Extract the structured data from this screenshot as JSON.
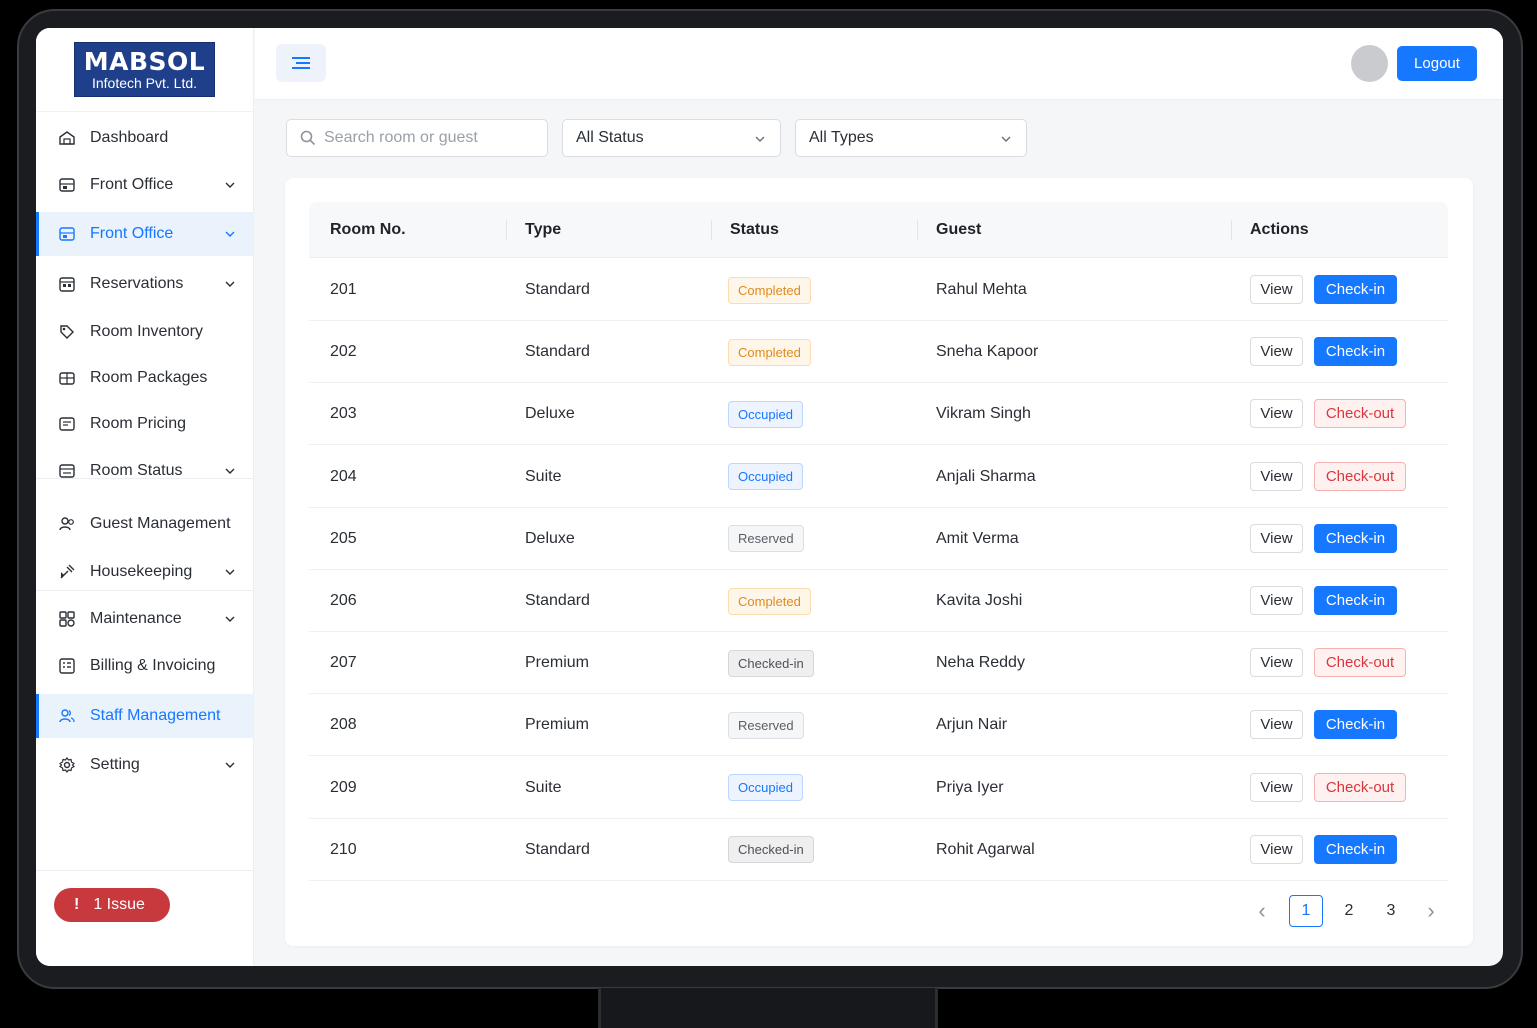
{
  "brand": {
    "line1": "MABSOL",
    "line2": "Infotech Pvt. Ltd."
  },
  "sidebar": {
    "items": [
      {
        "label": "Dashboard",
        "icon": "dashboard-icon",
        "chevron": false,
        "active": false
      },
      {
        "label": "Front Office",
        "icon": "front-office-icon",
        "chevron": true,
        "active": false
      },
      {
        "label": "Front Office",
        "icon": "front-office-icon",
        "chevron": true,
        "active": true
      },
      {
        "label": "Reservations",
        "icon": "reservations-icon",
        "chevron": true,
        "active": false
      },
      {
        "label": "Room Inventory",
        "icon": "room-inventory-icon",
        "chevron": false,
        "active": false
      },
      {
        "label": "Room Packages",
        "icon": "room-packages-icon",
        "chevron": false,
        "active": false
      },
      {
        "label": "Room Pricing",
        "icon": "room-pricing-icon",
        "chevron": false,
        "active": false
      },
      {
        "label": "Room Status",
        "icon": "room-status-icon",
        "chevron": true,
        "active": false
      },
      {
        "label": "Guest Management",
        "icon": "guest-management-icon",
        "chevron": false,
        "active": false
      },
      {
        "label": "Housekeeping",
        "icon": "housekeeping-icon",
        "chevron": true,
        "active": false
      },
      {
        "label": "Maintenance",
        "icon": "maintenance-icon",
        "chevron": true,
        "active": false
      },
      {
        "label": "Billing & Invoicing",
        "icon": "billing-icon",
        "chevron": false,
        "active": false
      },
      {
        "label": "Staff Management",
        "icon": "staff-management-icon",
        "chevron": false,
        "active": true
      },
      {
        "label": "Setting",
        "icon": "setting-icon",
        "chevron": true,
        "active": false
      }
    ],
    "issue_label": "1 Issue",
    "issue_mark": "!"
  },
  "header": {
    "logout_label": "Logout"
  },
  "filters": {
    "search_placeholder": "Search room or guest",
    "status_value": "All Status",
    "type_value": "All Types"
  },
  "table": {
    "columns": [
      "Room No.",
      "Type",
      "Status",
      "Guest",
      "Actions"
    ],
    "view_label": "View",
    "rows": [
      {
        "room": "201",
        "type": "Standard",
        "status": "Completed",
        "status_kind": "completed",
        "guest": "Rahul Mehta",
        "action": "Check-in",
        "action_kind": "checkin"
      },
      {
        "room": "202",
        "type": "Standard",
        "status": "Completed",
        "status_kind": "completed",
        "guest": "Sneha Kapoor",
        "action": "Check-in",
        "action_kind": "checkin"
      },
      {
        "room": "203",
        "type": "Deluxe",
        "status": "Occupied",
        "status_kind": "occupied",
        "guest": "Vikram Singh",
        "action": "Check-out",
        "action_kind": "checkout"
      },
      {
        "room": "204",
        "type": "Suite",
        "status": "Occupied",
        "status_kind": "occupied",
        "guest": "Anjali Sharma",
        "action": "Check-out",
        "action_kind": "checkout"
      },
      {
        "room": "205",
        "type": "Deluxe",
        "status": "Reserved",
        "status_kind": "reserved",
        "guest": "Amit Verma",
        "action": "Check-in",
        "action_kind": "checkin"
      },
      {
        "room": "206",
        "type": "Standard",
        "status": "Completed",
        "status_kind": "completed",
        "guest": "Kavita Joshi",
        "action": "Check-in",
        "action_kind": "checkin"
      },
      {
        "room": "207",
        "type": "Premium",
        "status": "Checked-in",
        "status_kind": "checkedin",
        "guest": "Neha Reddy",
        "action": "Check-out",
        "action_kind": "checkout"
      },
      {
        "room": "208",
        "type": "Premium",
        "status": "Reserved",
        "status_kind": "reserved",
        "guest": "Arjun Nair",
        "action": "Check-in",
        "action_kind": "checkin"
      },
      {
        "room": "209",
        "type": "Suite",
        "status": "Occupied",
        "status_kind": "occupied",
        "guest": "Priya Iyer",
        "action": "Check-out",
        "action_kind": "checkout"
      },
      {
        "room": "210",
        "type": "Standard",
        "status": "Checked-in",
        "status_kind": "checkedin",
        "guest": "Rohit Agarwal",
        "action": "Check-in",
        "action_kind": "checkin"
      }
    ]
  },
  "pagination": {
    "pages": [
      "1",
      "2",
      "3"
    ],
    "current": "1",
    "prev": "‹",
    "next": "›"
  },
  "colors": {
    "primary": "#1677ff",
    "danger": "#d9363e",
    "brand": "#1f3f8a",
    "issue": "#c8393e"
  }
}
